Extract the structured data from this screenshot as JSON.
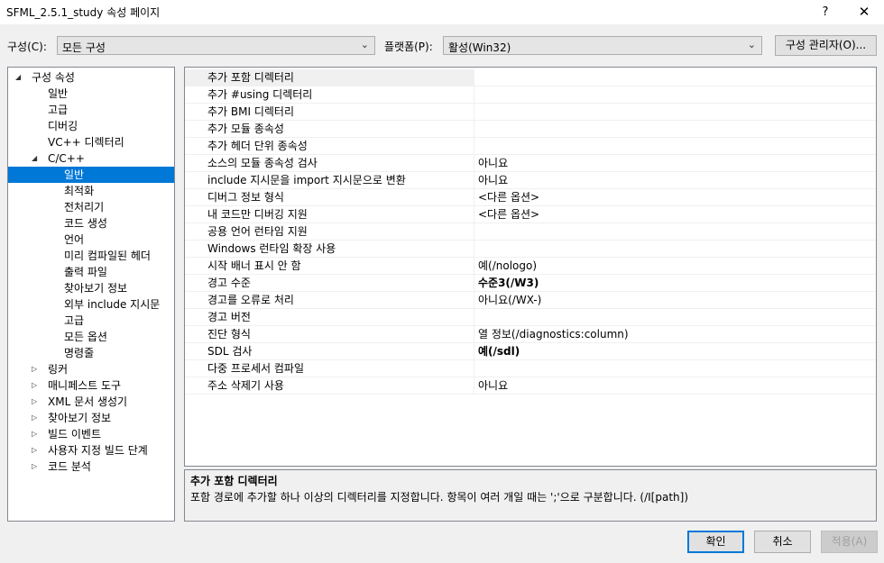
{
  "window": {
    "title": "SFML_2.5.1_study 속성 페이지",
    "help": "?",
    "close": "✕"
  },
  "toolbar": {
    "config_label": "구성(C):",
    "config_value": "모든 구성",
    "platform_label": "플랫폼(P):",
    "platform_value": "활성(Win32)",
    "config_manager": "구성 관리자(O)..."
  },
  "tree": [
    {
      "label": "구성 속성",
      "level": 0,
      "expander": "◢"
    },
    {
      "label": "일반",
      "level": 1
    },
    {
      "label": "고급",
      "level": 1
    },
    {
      "label": "디버깅",
      "level": 1
    },
    {
      "label": "VC++ 디렉터리",
      "level": 1
    },
    {
      "label": "C/C++",
      "level": 1,
      "expander": "◢"
    },
    {
      "label": "일반",
      "level": 2,
      "selected": true
    },
    {
      "label": "최적화",
      "level": 2
    },
    {
      "label": "전처리기",
      "level": 2
    },
    {
      "label": "코드 생성",
      "level": 2
    },
    {
      "label": "언어",
      "level": 2
    },
    {
      "label": "미리 컴파일된 헤더",
      "level": 2
    },
    {
      "label": "출력 파일",
      "level": 2
    },
    {
      "label": "찾아보기 정보",
      "level": 2
    },
    {
      "label": "외부 include 지시문",
      "level": 2
    },
    {
      "label": "고급",
      "level": 2
    },
    {
      "label": "모든 옵션",
      "level": 2
    },
    {
      "label": "명령줄",
      "level": 2
    },
    {
      "label": "링커",
      "level": 1,
      "expander": "▷"
    },
    {
      "label": "매니페스트 도구",
      "level": 1,
      "expander": "▷"
    },
    {
      "label": "XML 문서 생성기",
      "level": 1,
      "expander": "▷"
    },
    {
      "label": "찾아보기 정보",
      "level": 1,
      "expander": "▷"
    },
    {
      "label": "빌드 이벤트",
      "level": 1,
      "expander": "▷"
    },
    {
      "label": "사용자 지정 빌드 단계",
      "level": 1,
      "expander": "▷"
    },
    {
      "label": "코드 분석",
      "level": 1,
      "expander": "▷"
    }
  ],
  "properties": [
    {
      "name": "추가 포함 디렉터리",
      "value": "",
      "selected": true
    },
    {
      "name": "추가 #using 디렉터리",
      "value": ""
    },
    {
      "name": "추가 BMI 디렉터리",
      "value": ""
    },
    {
      "name": "추가 모듈 종속성",
      "value": ""
    },
    {
      "name": "추가 헤더 단위 종속성",
      "value": ""
    },
    {
      "name": "소스의 모듈 종속성 검사",
      "value": "아니요"
    },
    {
      "name": "include 지시문을 import 지시문으로 변환",
      "value": "아니요"
    },
    {
      "name": "디버그 정보 형식",
      "value": "<다른 옵션>"
    },
    {
      "name": "내 코드만 디버깅 지원",
      "value": "<다른 옵션>"
    },
    {
      "name": "공용 언어 런타임 지원",
      "value": ""
    },
    {
      "name": "Windows 런타임 확장 사용",
      "value": ""
    },
    {
      "name": "시작 배너 표시 안 함",
      "value": "예(/nologo)"
    },
    {
      "name": "경고 수준",
      "value": "수준3(/W3)",
      "bold": true
    },
    {
      "name": "경고를 오류로 처리",
      "value": "아니요(/WX-)"
    },
    {
      "name": "경고 버전",
      "value": ""
    },
    {
      "name": "진단 형식",
      "value": "열 정보(/diagnostics:column)"
    },
    {
      "name": "SDL 검사",
      "value": "예(/sdl)",
      "bold": true
    },
    {
      "name": "다중 프로세서 컴파일",
      "value": ""
    },
    {
      "name": "주소 삭제기 사용",
      "value": "아니요"
    }
  ],
  "description": {
    "title": "추가 포함 디렉터리",
    "text": "포함 경로에 추가할 하나 이상의 디렉터리를 지정합니다. 항목이 여러 개일 때는 ';'으로 구분합니다. (/I[path])"
  },
  "buttons": {
    "ok": "확인",
    "cancel": "취소",
    "apply": "적용(A)"
  },
  "colors": {
    "selection": "#0078d7",
    "background": "#f0f0f0"
  }
}
